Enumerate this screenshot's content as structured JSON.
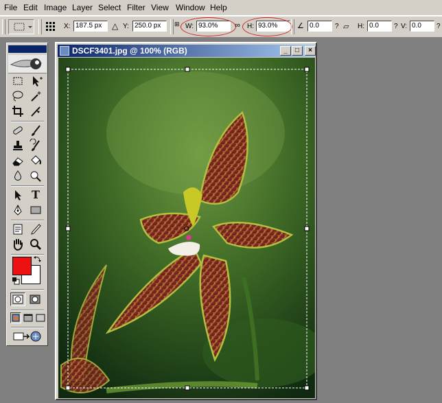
{
  "menu": [
    "File",
    "Edit",
    "Image",
    "Layer",
    "Select",
    "Filter",
    "View",
    "Window",
    "Help"
  ],
  "options": {
    "x_label": "X:",
    "x_value": "187.5 px",
    "y_label": "Y:",
    "y_value": "250.0 px",
    "w_label": "W:",
    "w_value": "93.0%",
    "h_label": "H:",
    "h_value": "93.0%",
    "angle_value": "0.0",
    "skew_h_label": "H:",
    "skew_h_value": "0.0",
    "skew_v_label": "V:",
    "skew_v_value": "0.0",
    "q1": "?",
    "q2": "?",
    "q3": "?"
  },
  "toolbox": {
    "type_tool_glyph": "T"
  },
  "document": {
    "title": "DSCF3401.jpg @ 100% (RGB)",
    "minimize": "_",
    "maximize": "□",
    "close": "×"
  },
  "colors": {
    "foreground": "#ee1111",
    "background": "#ffffff",
    "annotation_ring": "#d42020",
    "title_bar": "#0a246a"
  }
}
